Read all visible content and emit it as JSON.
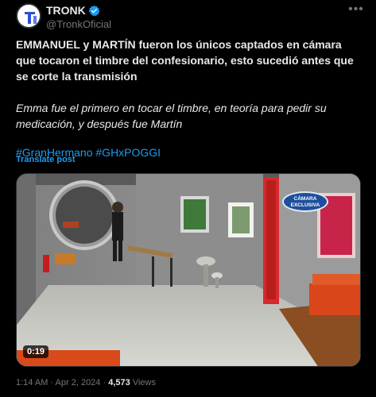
{
  "account": {
    "display_name": "TRONK",
    "handle": "@TronkOficial",
    "avatar_icon": "tronk-logo",
    "verified_icon": "verified-badge-icon",
    "accent_color": "#1d9bf0"
  },
  "more_icon": "more-icon",
  "tweet": {
    "paragraph1": "EMMANUEL y MARTÍN fueron los únicos captados en cámara que tocaron el timbre del confesionario, esto sucedió antes que se corte la transmisión",
    "paragraph2": "Emma fue el primero en tocar el timbre, en teoría para pedir su medicación, y después fue Martín",
    "hashtags": [
      "#GranHermano",
      "#GHxPOGGI"
    ],
    "translate_label": "Translate post"
  },
  "media": {
    "duration": "0:19",
    "badge_line1": "CÁMARA",
    "badge_line2": "EXCLUSIVA"
  },
  "meta": {
    "time": "1:14 AM",
    "separator": "·",
    "date": "Apr 2, 2024",
    "views_count": "4,573",
    "views_label": "Views"
  }
}
